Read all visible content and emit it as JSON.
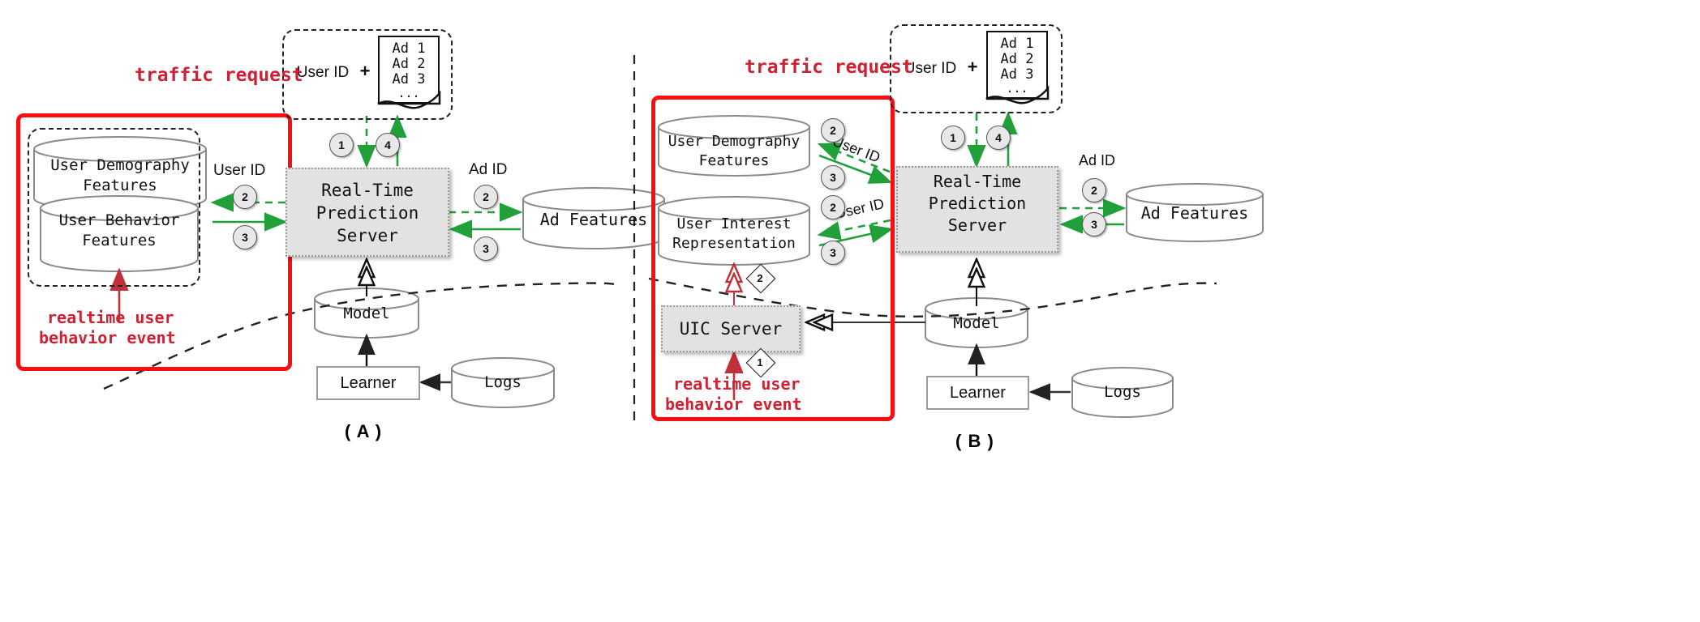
{
  "figure": {
    "panels": [
      {
        "id": "A",
        "tag": "( A )",
        "traffic_request_label": "traffic request",
        "request_box": {
          "user_id": "User ID",
          "plus": "+",
          "ad_lines": [
            "Ad 1",
            "Ad 2",
            "Ad 3",
            "..."
          ]
        },
        "prediction_server": "Real-Time\nPrediction\nServer",
        "prediction_server_lines": [
          "Real-Time",
          "Prediction",
          "Server"
        ],
        "stores": {
          "demography": [
            "User Demography",
            "Features"
          ],
          "behavior": [
            "User Behavior",
            "Features"
          ],
          "ad_features": "Ad Features",
          "model": "Model",
          "logs": "Logs"
        },
        "learner": "Learner",
        "edge_labels": {
          "user_id": "User ID",
          "ad_id": "Ad ID"
        },
        "step_numbers": {
          "request_in": "1",
          "response_out": "4",
          "lookup": "2",
          "return": "3",
          "ad_lookup": "2",
          "ad_return": "3"
        },
        "note": [
          "realtime user",
          "behavior event"
        ]
      },
      {
        "id": "B",
        "tag": "( B )",
        "traffic_request_label": "traffic request",
        "request_box": {
          "user_id": "User ID",
          "plus": "+",
          "ad_lines": [
            "Ad 1",
            "Ad 2",
            "Ad 3",
            "..."
          ]
        },
        "prediction_server_lines": [
          "Real-Time",
          "Prediction",
          "Server"
        ],
        "stores": {
          "demography": [
            "User Demography",
            "Features"
          ],
          "interest": [
            "User Interest",
            "Representation"
          ],
          "ad_features": "Ad Features",
          "model": "Model",
          "logs": "Logs"
        },
        "uic_server": "UIC Server",
        "learner": "Learner",
        "edge_labels": {
          "user_id_top": "User ID",
          "user_id_bottom": "User ID",
          "ad_id": "Ad ID"
        },
        "step_numbers": {
          "request_in": "1",
          "response_out": "4",
          "demo_lookup": "2",
          "demo_return": "3",
          "interest_lookup": "2",
          "interest_return": "3",
          "ad_lookup": "2",
          "ad_return": "3"
        },
        "diamond_numbers": {
          "event_in": "1",
          "update_out": "2"
        },
        "note": [
          "realtime user",
          "behavior event"
        ]
      }
    ],
    "colors": {
      "highlight_red": "#fb0d12",
      "note_red": "#cc2233",
      "flow_green": "#21a03a",
      "server_fill": "#e2e2e2",
      "circle_fill": "#e8e8e8"
    }
  }
}
